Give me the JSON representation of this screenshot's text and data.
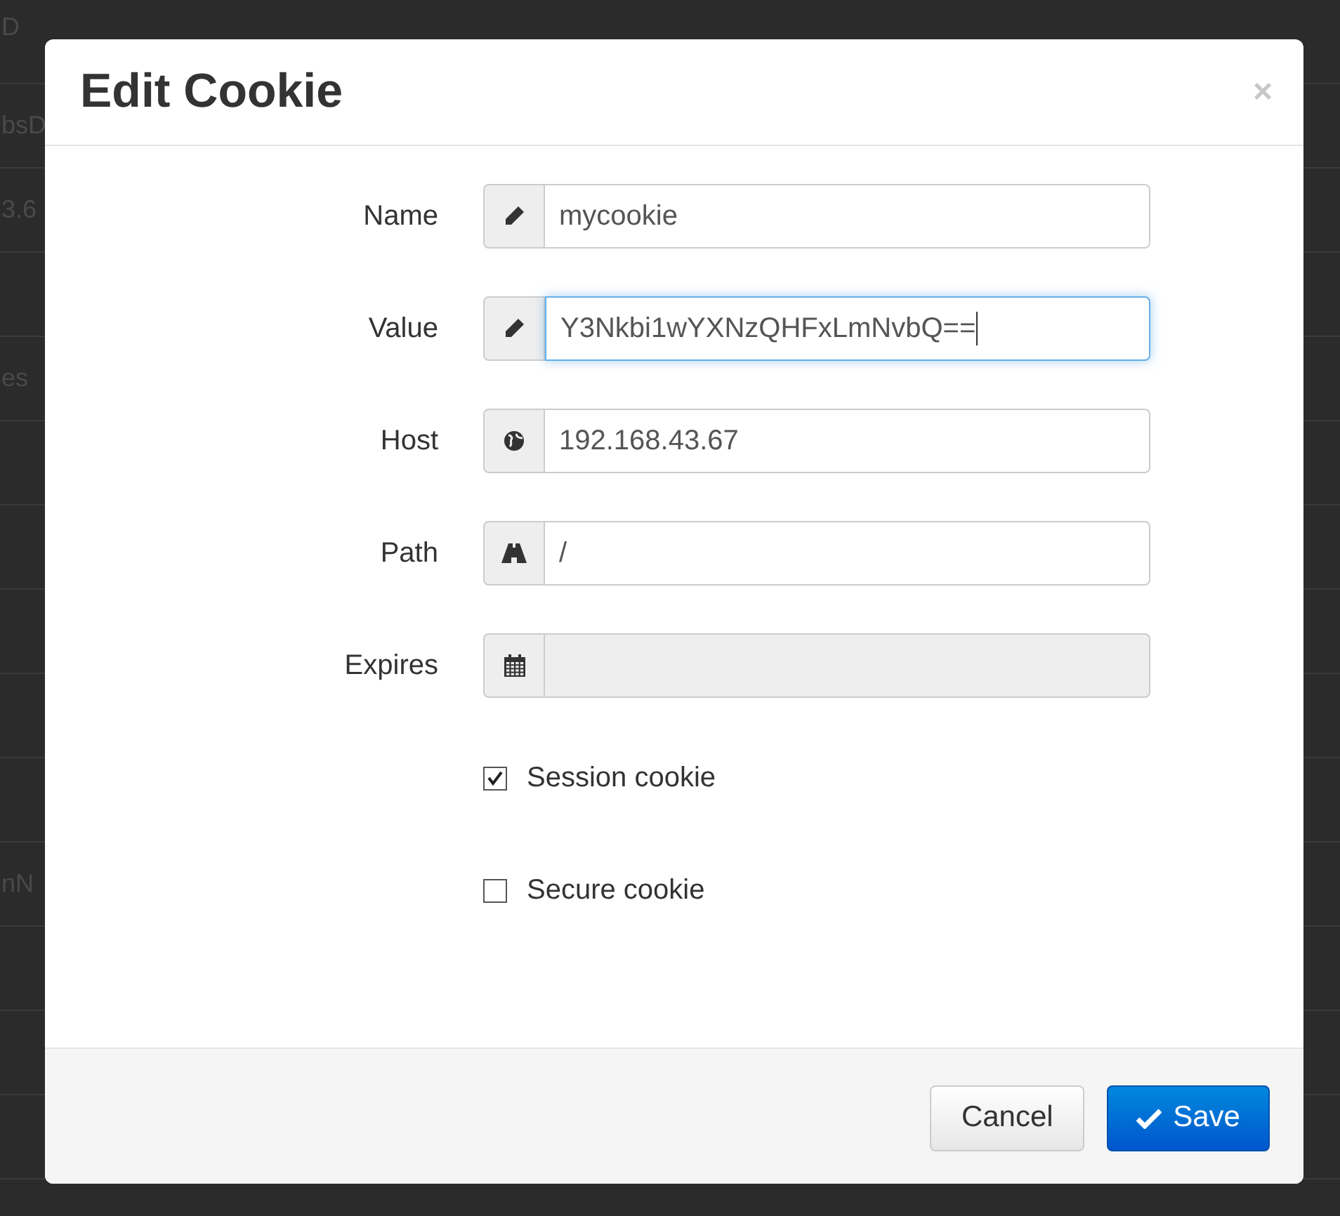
{
  "background_table": {
    "cells": [
      {
        "text": "D"
      },
      {
        "text": "bsD"
      },
      {
        "text": "3.6"
      },
      {
        "text": ""
      },
      {
        "text": "es"
      },
      {
        "text": ""
      },
      {
        "text": ""
      },
      {
        "text": ""
      },
      {
        "text": ""
      },
      {
        "text": ""
      },
      {
        "text": "nN"
      },
      {
        "text": ""
      },
      {
        "text": ""
      },
      {
        "text": ""
      }
    ]
  },
  "dialog": {
    "title": "Edit Cookie",
    "close": "×",
    "fields": [
      {
        "label": "Name",
        "value": "mycookie",
        "focused": false,
        "disabled": false
      },
      {
        "label": "Value",
        "value": "Y3Nkbi1wYXNzQHFxLmNvbQ==",
        "focused": true,
        "disabled": false
      },
      {
        "label": "Host",
        "value": "192.168.43.67",
        "focused": false,
        "disabled": false
      },
      {
        "label": "Path",
        "value": "/",
        "focused": false,
        "disabled": false
      },
      {
        "label": "Expires",
        "focused": false,
        "disabled": true
      }
    ],
    "checkboxes": [
      {
        "label": "Session cookie",
        "checked": true
      },
      {
        "label": "Secure cookie",
        "checked": false
      }
    ],
    "buttons": [
      {
        "label": "Cancel",
        "kind": "default"
      },
      {
        "label": "Save",
        "kind": "primary"
      }
    ]
  }
}
